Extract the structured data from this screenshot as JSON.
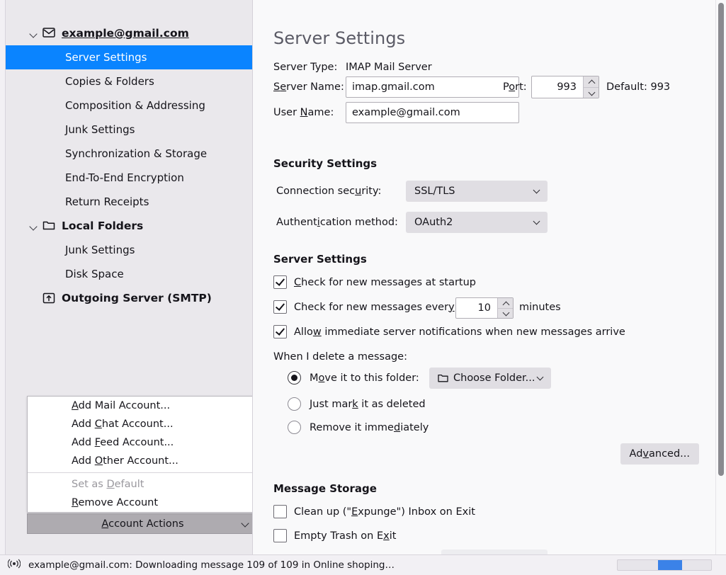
{
  "sidebar": {
    "account": {
      "label": "example@gmail.com",
      "icon": "envelope-icon"
    },
    "account_items": [
      {
        "label": "Server Settings",
        "selected": true
      },
      {
        "label": "Copies & Folders",
        "selected": false
      },
      {
        "label": "Composition & Addressing",
        "selected": false
      },
      {
        "label": "Junk Settings",
        "selected": false
      },
      {
        "label": "Synchronization & Storage",
        "selected": false
      },
      {
        "label": "End-To-End Encryption",
        "selected": false
      },
      {
        "label": "Return Receipts",
        "selected": false
      }
    ],
    "local_folders": {
      "label": "Local Folders",
      "icon": "folder-icon"
    },
    "local_items": [
      {
        "label": "Junk Settings"
      },
      {
        "label": "Disk Space"
      }
    ],
    "smtp": {
      "label": "Outgoing Server (SMTP)",
      "icon": "outgoing-server-icon"
    },
    "account_actions": {
      "button_label_pre": "A",
      "button_label_post": "ccount Actions",
      "menu_items": [
        {
          "pre": "",
          "accel": "A",
          "post": "dd Mail Account...",
          "disabled": false
        },
        {
          "pre": "Add ",
          "accel": "C",
          "post": "hat Account...",
          "disabled": false
        },
        {
          "pre": "Add ",
          "accel": "F",
          "post": "eed Account...",
          "disabled": false
        },
        {
          "pre": "Add ",
          "accel": "O",
          "post": "ther Account...",
          "disabled": false
        },
        {
          "pre": "Set as ",
          "accel": "D",
          "post": "efault",
          "disabled": true
        },
        {
          "pre": "",
          "accel": "R",
          "post": "emove Account",
          "disabled": false
        }
      ]
    }
  },
  "main": {
    "title": "Server Settings",
    "server_type_label": "Server Type:",
    "server_type_value": "IMAP Mail Server",
    "server_name_label_pre": "S",
    "server_name_label_accel": "e",
    "server_name_label_post": "rver Name:",
    "server_name_value": "imap.gmail.com",
    "port_label_pre": "P",
    "port_label_accel": "o",
    "port_label_post": "rt:",
    "port_value": "993",
    "port_default": "Default: 993",
    "user_name_label_pre": "User ",
    "user_name_label_accel": "N",
    "user_name_label_post": "ame:",
    "user_name_value": "example@gmail.com",
    "security_heading": "Security Settings",
    "connection_security_label_pre": "Connection sec",
    "connection_security_label_accel": "u",
    "connection_security_label_post": "rity:",
    "connection_security_value": "SSL/TLS",
    "auth_method_label_pre": "Authent",
    "auth_method_label_accel": "i",
    "auth_method_label_post": "cation method:",
    "auth_method_value": "OAuth2",
    "server_settings_heading": "Server Settings",
    "check_startup_pre": "",
    "check_startup_accel": "C",
    "check_startup_post": "heck for new messages at startup",
    "check_startup_checked": true,
    "check_every_pre": "Check for new messages ever",
    "check_every_accel": "y",
    "check_every_post": "",
    "check_every_checked": true,
    "check_every_value": "10",
    "minutes_label": "minutes",
    "allow_notifications_pre": "Allo",
    "allow_notifications_accel": "w",
    "allow_notifications_post": " immediate server notifications when new messages arrive",
    "allow_notifications_checked": true,
    "delete_heading": "When I delete a message:",
    "delete_options": [
      {
        "pre": "M",
        "accel": "o",
        "post": "ve it to this folder:",
        "selected": true
      },
      {
        "pre": "Just mar",
        "accel": "k",
        "post": " it as deleted",
        "selected": false
      },
      {
        "pre": "Remove it imme",
        "accel": "d",
        "post": "iately",
        "selected": false
      }
    ],
    "choose_folder_label": "Choose Folder...",
    "choose_folder_icon": "folder-icon",
    "advanced_pre": "Ad",
    "advanced_accel": "v",
    "advanced_post": "anced...",
    "message_storage_heading": "Message Storage",
    "expunge_pre": "Clean up (\"",
    "expunge_accel": "E",
    "expunge_post": "xpunge\") Inbox on Exit",
    "expunge_checked": false,
    "empty_trash_pre": "Empty Trash on E",
    "empty_trash_accel": "x",
    "empty_trash_post": "it",
    "empty_trash_checked": false
  },
  "statusbar": {
    "icon": "activity-broadcast-icon",
    "text": "example@gmail.com: Downloading message 109 of 109 in Online shoping…",
    "progress_indeterminate": true
  },
  "colors": {
    "accent": "#0a84ff",
    "sidebar_bg": "#eae8ec",
    "content_bg": "#f9f9fa",
    "progress": "#3b82e8"
  }
}
